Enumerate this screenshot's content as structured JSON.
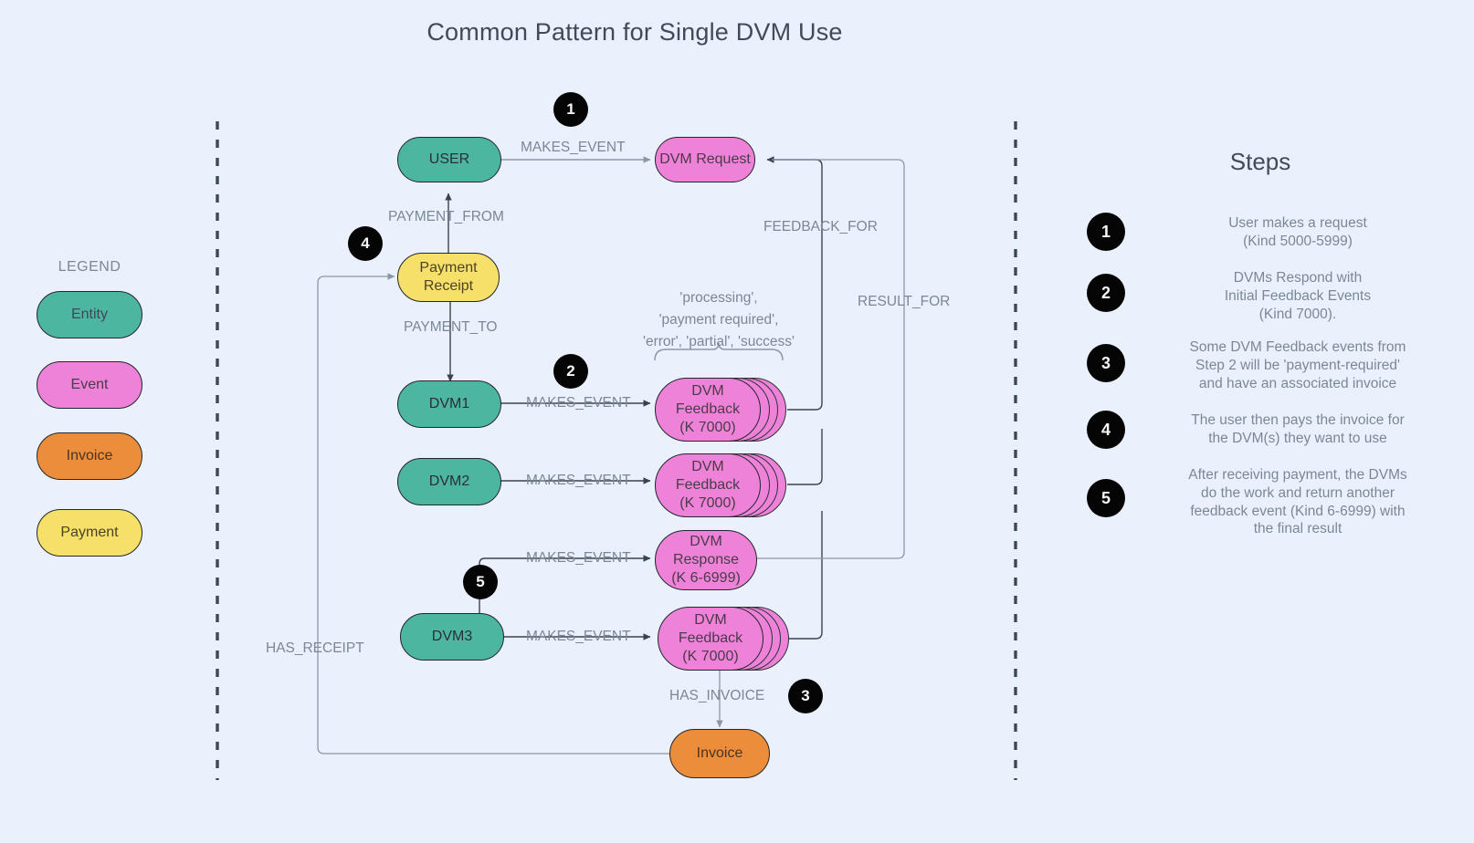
{
  "page": {
    "title": "Common Pattern for Single DVM Use",
    "background_color": "#eaf1fc"
  },
  "colors": {
    "entity": "#4db6a0",
    "event": "#ee82d8",
    "invoice": "#eb8d3a",
    "payment": "#f7e06a",
    "badge": "#050505",
    "edge": "#4a5261",
    "label_text": "#7c8796"
  },
  "legend": {
    "heading": "LEGEND",
    "items": [
      {
        "label": "Entity",
        "type": "entity"
      },
      {
        "label": "Event",
        "type": "event"
      },
      {
        "label": "Invoice",
        "type": "invoice"
      },
      {
        "label": "Payment",
        "type": "payment"
      }
    ]
  },
  "graph": {
    "nodes": [
      {
        "id": "user",
        "label": "USER",
        "type": "entity"
      },
      {
        "id": "dvm_request",
        "label": "DVM Request",
        "type": "event"
      },
      {
        "id": "payment_receipt",
        "label": "Payment\nReceipt",
        "type": "payment"
      },
      {
        "id": "dvm1",
        "label": "DVM1",
        "type": "entity"
      },
      {
        "id": "dvm2",
        "label": "DVM2",
        "type": "entity"
      },
      {
        "id": "dvm3",
        "label": "DVM3",
        "type": "entity"
      },
      {
        "id": "feedback1",
        "label": "DVM\nFeedback\n(K 7000)",
        "type": "event",
        "stacked": true
      },
      {
        "id": "feedback2",
        "label": "DVM\nFeedback\n(K 7000)",
        "type": "event",
        "stacked": true
      },
      {
        "id": "feedback3",
        "label": "DVM\nFeedback\n(K 7000)",
        "type": "event",
        "stacked": true
      },
      {
        "id": "dvm_response",
        "label": "DVM\nResponse\n(K 6-6999)",
        "type": "event"
      },
      {
        "id": "invoice",
        "label": "Invoice",
        "type": "invoice"
      }
    ],
    "edge_labels": [
      {
        "id": "e1",
        "label": "MAKES_EVENT"
      },
      {
        "id": "e2",
        "label": "PAYMENT_FROM"
      },
      {
        "id": "e3",
        "label": "PAYMENT_TO"
      },
      {
        "id": "e4",
        "label": "MAKES_EVENT"
      },
      {
        "id": "e5",
        "label": "MAKES_EVENT"
      },
      {
        "id": "e6",
        "label": "MAKES_EVENT"
      },
      {
        "id": "e7",
        "label": "MAKES_EVENT"
      },
      {
        "id": "e8",
        "label": "FEEDBACK_FOR"
      },
      {
        "id": "e9",
        "label": "RESULT_FOR"
      },
      {
        "id": "e10",
        "label": "HAS_INVOICE"
      },
      {
        "id": "e11",
        "label": "HAS_RECEIPT"
      }
    ],
    "annotation": "'processing',\n'payment required',\n'error', 'partial', 'success'"
  },
  "inline_badges": [
    {
      "n": "1"
    },
    {
      "n": "4"
    },
    {
      "n": "2"
    },
    {
      "n": "5"
    },
    {
      "n": "3"
    }
  ],
  "steps": {
    "heading": "Steps",
    "items": [
      {
        "n": "1",
        "text": "User makes a request\n(Kind 5000-5999)"
      },
      {
        "n": "2",
        "text": "DVMs Respond with\nInitial Feedback Events\n(Kind 7000)."
      },
      {
        "n": "3",
        "text": "Some DVM Feedback events from\nStep 2 will be 'payment-required'\nand have an associated invoice"
      },
      {
        "n": "4",
        "text": "The user then pays the invoice for\nthe DVM(s) they want to use"
      },
      {
        "n": "5",
        "text": "After receiving payment, the DVMs\ndo the work and return another\nfeedback event (Kind 6-6999) with\nthe final result"
      }
    ]
  }
}
